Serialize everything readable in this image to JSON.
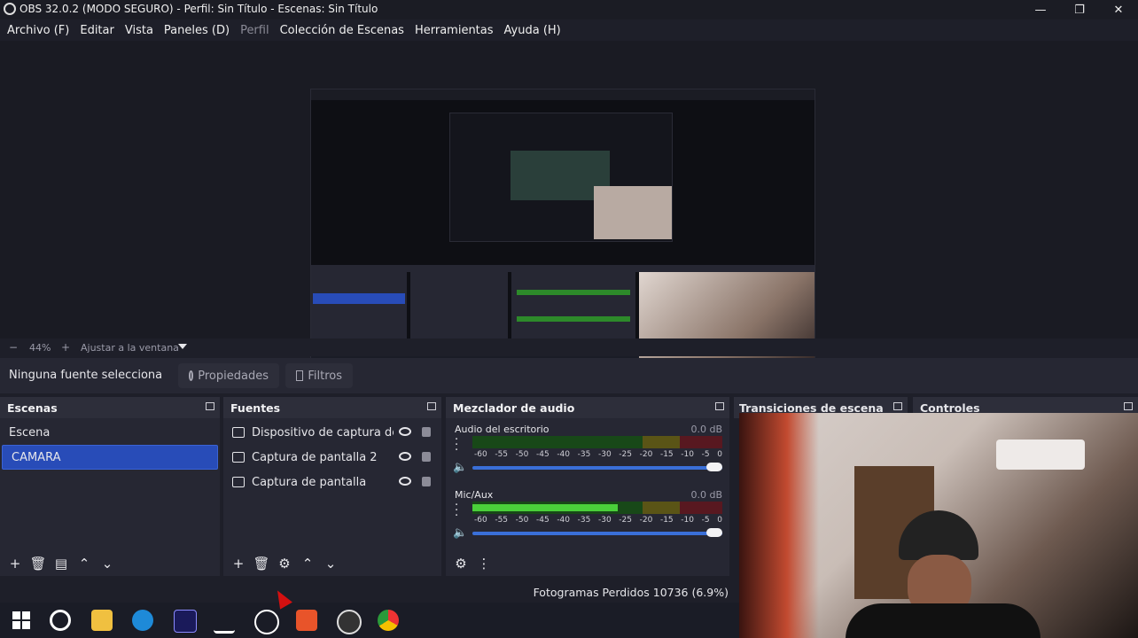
{
  "window": {
    "title": "OBS 32.0.2 (MODO SEGURO) - Perfil: Sin Título - Escenas: Sin Título",
    "minimize_glyph": "—",
    "maximize_glyph": "❐",
    "close_glyph": "✕"
  },
  "menu": {
    "items": [
      {
        "label": "Archivo (F)",
        "enabled": true
      },
      {
        "label": "Editar",
        "enabled": true
      },
      {
        "label": "Vista",
        "enabled": true
      },
      {
        "label": "Paneles (D)",
        "enabled": true
      },
      {
        "label": "Perfil",
        "enabled": false
      },
      {
        "label": "Colección de Escenas",
        "enabled": true
      },
      {
        "label": "Herramientas",
        "enabled": true
      },
      {
        "label": "Ayuda (H)",
        "enabled": true
      }
    ]
  },
  "zoom": {
    "minus": "−",
    "value": "44%",
    "plus": "+",
    "fit_label": "Ajustar a la ventana"
  },
  "context_bar": {
    "no_source": "Ninguna fuente selecciona",
    "properties_label": "Propiedades",
    "filters_label": "Filtros"
  },
  "docks": {
    "scenes": {
      "title": "Escenas",
      "items": [
        {
          "label": "Escena",
          "selected": false
        },
        {
          "label": "CAMARA",
          "selected": true
        }
      ]
    },
    "sources": {
      "title": "Fuentes",
      "items": [
        {
          "label": "Dispositivo de captura de vic",
          "icon": "camera-icon"
        },
        {
          "label": "Captura de pantalla 2",
          "icon": "monitor-icon"
        },
        {
          "label": "Captura de pantalla",
          "icon": "monitor-icon"
        }
      ]
    },
    "mixer": {
      "title": "Mezclador de audio",
      "ticks": [
        "-60",
        "-55",
        "-50",
        "-45",
        "-40",
        "-35",
        "-30",
        "-25",
        "-20",
        "-15",
        "-10",
        "-5",
        "0"
      ],
      "channels": [
        {
          "name": "Audio del escritorio",
          "db": "0.0 dB",
          "level_left": 0,
          "level_right": 0,
          "volume": 1.0
        },
        {
          "name": "Mic/Aux",
          "db": "0.0 dB",
          "level_left": 0.45,
          "level_right": 0.58,
          "volume": 1.0
        }
      ]
    },
    "transitions": {
      "title": "Transiciones de escena"
    },
    "controls": {
      "title": "Controles"
    }
  },
  "status": {
    "dropped_frames": "Fotogramas Perdidos 10736 (6.9%)"
  },
  "colors": {
    "accent": "#284cb8",
    "meter_green": "#4ad03a",
    "meter_yellow": "#5a5416",
    "meter_red": "#581820"
  }
}
